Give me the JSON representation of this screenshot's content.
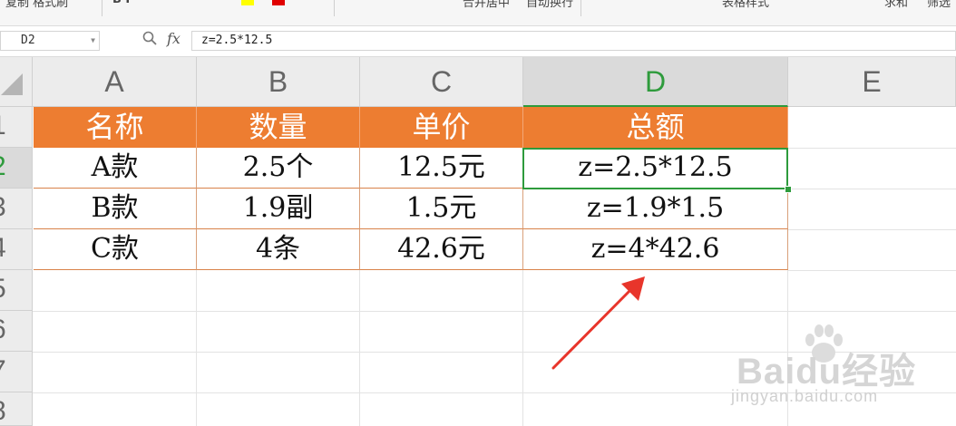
{
  "toolbar": {
    "items": [
      "复制  格式刷",
      "B  I",
      "合并居中",
      "自动换行",
      "表格样式",
      "求和",
      "筛选"
    ],
    "swatch_colors": [
      "#ffff00",
      "#e00000"
    ]
  },
  "formula_bar": {
    "name_box": "D2",
    "fx_label": "fx",
    "formula": "z=2.5*12.5"
  },
  "columns": [
    "A",
    "B",
    "C",
    "D",
    "E"
  ],
  "active_column": "D",
  "rows": [
    "1",
    "2",
    "3",
    "4",
    "5",
    "6",
    "7",
    "8"
  ],
  "active_row": "2",
  "table": {
    "headers": [
      "名称",
      "数量",
      "单价",
      "总额"
    ],
    "rows": [
      [
        "A款",
        "2.5个",
        "12.5元",
        "z=2.5*12.5"
      ],
      [
        "B款",
        "1.9副",
        "1.5元",
        "z=1.9*1.5"
      ],
      [
        "C款",
        "4条",
        "42.6元",
        "z=4*42.6"
      ]
    ],
    "header_color": "#ed7d31"
  },
  "selection": {
    "cell": "D2",
    "color": "#2e9b3c"
  },
  "annotation": {
    "color": "#e8352b",
    "icon": "red-arrow-icon"
  },
  "watermark": {
    "logo": "Baidu经验",
    "url": "jingyan.baidu.com"
  }
}
